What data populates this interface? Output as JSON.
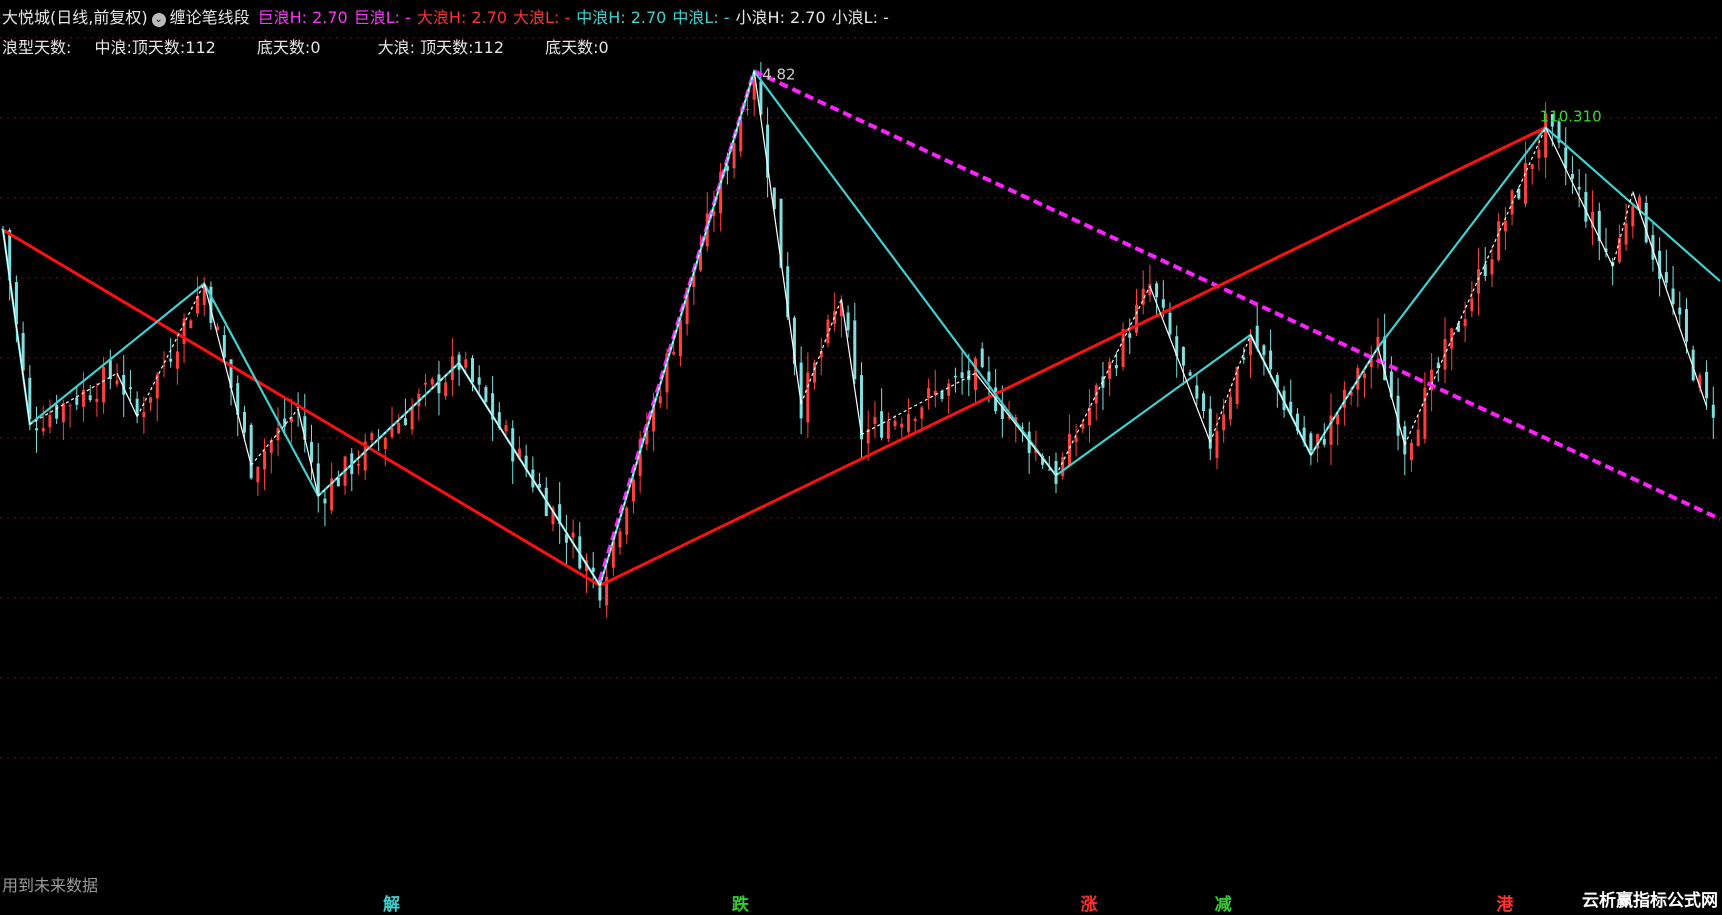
{
  "header": {
    "title": "大悦城(日线,前复权)",
    "indicator": "缠论笔线段",
    "fields": [
      {
        "label": "巨浪H: 2.70",
        "color": "#ff33ff"
      },
      {
        "label": "巨浪L: -",
        "color": "#ff33ff"
      },
      {
        "label": "大浪H: 2.70",
        "color": "#ff3030"
      },
      {
        "label": "大浪L: -",
        "color": "#ff3030"
      },
      {
        "label": "中浪H: 2.70",
        "color": "#40d0d0"
      },
      {
        "label": "中浪L: -",
        "color": "#40d0d0"
      },
      {
        "label": "小浪H: 2.70",
        "color": "#e6e6e6"
      },
      {
        "label": "小浪L: -",
        "color": "#e6e6e6"
      }
    ]
  },
  "stats": {
    "label": "浪型天数:",
    "mid_top": "中浪:顶天数:112",
    "mid_bottom": "底天数:0",
    "big_top": "大浪: 顶天数:112",
    "big_bottom": "底天数:0"
  },
  "footer": {
    "note": "用到未来数据",
    "watermark": "云析赢指标公式网"
  },
  "bottom_marks": [
    {
      "text": "解",
      "color": "#40d0d0",
      "index": 58
    },
    {
      "text": "跌",
      "color": "#33cc33",
      "index": 110
    },
    {
      "text": "涨",
      "color": "#ff3030",
      "index": 162
    },
    {
      "text": "减",
      "color": "#33cc33",
      "index": 182
    },
    {
      "text": "港",
      "color": "#ff3030",
      "index": 224
    }
  ],
  "colors": {
    "up_candle": "#ff4040",
    "down_candle": "#7fe0e0",
    "giant_wave": "#ff22ff",
    "big_wave": "#ff1010",
    "mid_wave": "#40d0d0",
    "small_wave": "#ffffff",
    "grid": "#7a1010"
  },
  "chart_data": {
    "type": "line",
    "title": "",
    "xlabel": "",
    "ylabel": "",
    "x_range": [
      0,
      256
    ],
    "ylim": [
      2.3,
      4.95
    ],
    "annotations": [
      {
        "text": "4.82",
        "index": 112,
        "value": 4.82
      },
      {
        "text": "110.310",
        "index": 230,
        "value": 4.6,
        "color": "#33dd33"
      }
    ],
    "series": [
      {
        "key": "giant_wave",
        "style": "dashed",
        "points": [
          [
            89,
            2.83
          ],
          [
            112,
            4.82
          ],
          [
            256,
            3.07
          ]
        ]
      },
      {
        "key": "big_wave",
        "style": "solid",
        "points": [
          [
            0,
            4.2
          ],
          [
            89,
            2.81
          ],
          [
            230,
            4.6
          ]
        ]
      },
      {
        "key": "mid_wave",
        "style": "solid",
        "points": [
          [
            0,
            4.2
          ],
          [
            4,
            3.44
          ],
          [
            30,
            3.99
          ],
          [
            47,
            3.16
          ],
          [
            68,
            3.68
          ],
          [
            89,
            2.81
          ],
          [
            112,
            4.82
          ],
          [
            157,
            3.24
          ],
          [
            186,
            3.79
          ],
          [
            195,
            3.32
          ],
          [
            205,
            3.74
          ],
          [
            230,
            4.6
          ],
          [
            256,
            4.0
          ]
        ]
      },
      {
        "key": "small_wave",
        "style": "mixed",
        "points": [
          [
            0,
            4.2
          ],
          [
            4,
            3.44
          ],
          [
            17,
            3.64
          ],
          [
            20,
            3.47
          ],
          [
            30,
            3.99
          ],
          [
            37,
            3.28
          ],
          [
            44,
            3.5
          ],
          [
            47,
            3.16
          ],
          [
            68,
            3.68
          ],
          [
            89,
            2.81
          ],
          [
            112,
            4.82
          ],
          [
            119,
            3.52
          ],
          [
            125,
            3.93
          ],
          [
            128,
            3.4
          ],
          [
            145,
            3.64
          ],
          [
            157,
            3.24
          ],
          [
            171,
            3.98
          ],
          [
            180,
            3.37
          ],
          [
            186,
            3.79
          ],
          [
            195,
            3.32
          ],
          [
            205,
            3.74
          ],
          [
            209,
            3.36
          ],
          [
            230,
            4.6
          ],
          [
            240,
            4.06
          ],
          [
            243,
            4.35
          ],
          [
            254,
            3.51
          ]
        ]
      }
    ]
  }
}
